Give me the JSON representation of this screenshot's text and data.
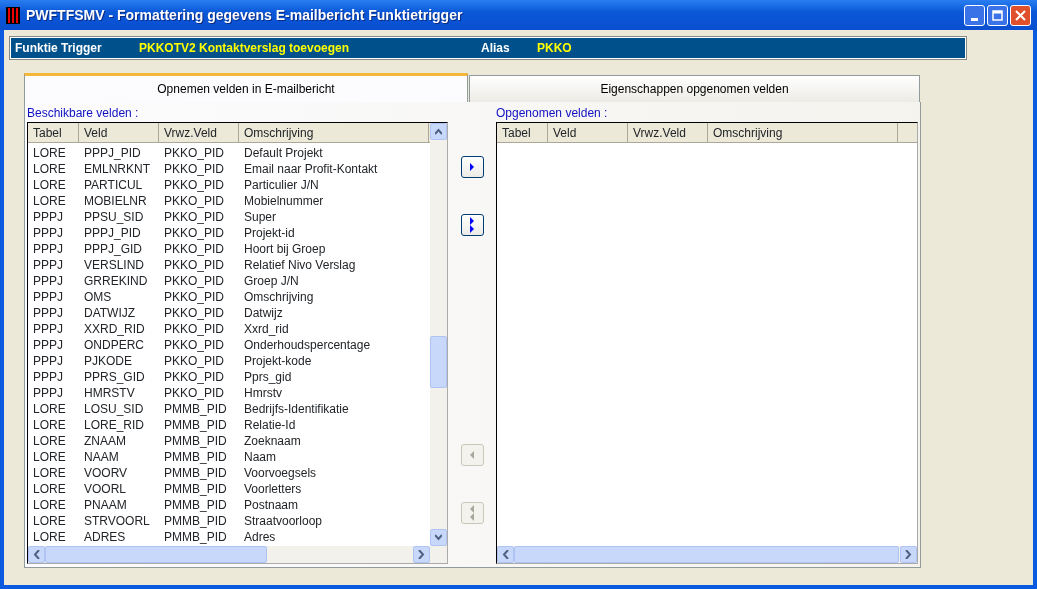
{
  "window": {
    "title": "PWFTFSMV - Formattering gegevens E-mailbericht Funktietrigger"
  },
  "header": {
    "label": "Funktie Trigger",
    "value": "PKKOTV2  Kontaktverslag toevoegen",
    "alias_label": "Alias",
    "alias_value": "PKKO"
  },
  "tabs": [
    {
      "label": "Opnemen velden in E-mailbericht",
      "selected": true
    },
    {
      "label": "Eigenschappen opgenomen velden",
      "selected": false
    }
  ],
  "available": {
    "title": "Beschikbare velden :",
    "columns": [
      "Tabel",
      "Veld",
      "Vrwz.Veld",
      "Omschrijving"
    ],
    "rows": [
      [
        "LORE",
        "PPPJ_PID",
        "PKKO_PID",
        "Default Projekt"
      ],
      [
        "LORE",
        "EMLNRKNT",
        "PKKO_PID",
        "Email naar Profit-Kontakt"
      ],
      [
        "LORE",
        "PARTICUL",
        "PKKO_PID",
        "Particulier J/N"
      ],
      [
        "LORE",
        "MOBIELNR",
        "PKKO_PID",
        "Mobielnummer"
      ],
      [
        "PPPJ",
        "PPSU_SID",
        "PKKO_PID",
        "Super"
      ],
      [
        "PPPJ",
        "PPPJ_PID",
        "PKKO_PID",
        "Projekt-id"
      ],
      [
        "PPPJ",
        "PPPJ_GID",
        "PKKO_PID",
        "Hoort bij Groep"
      ],
      [
        "PPPJ",
        "VERSLIND",
        "PKKO_PID",
        "Relatief Nivo Verslag"
      ],
      [
        "PPPJ",
        "GRREKIND",
        "PKKO_PID",
        "Groep J/N"
      ],
      [
        "PPPJ",
        "OMS",
        "PKKO_PID",
        "Omschrijving"
      ],
      [
        "PPPJ",
        "DATWIJZ",
        "PKKO_PID",
        "Datwijz"
      ],
      [
        "PPPJ",
        "XXRD_RID",
        "PKKO_PID",
        "Xxrd_rid"
      ],
      [
        "PPPJ",
        "ONDPERC",
        "PKKO_PID",
        "Onderhoudspercentage"
      ],
      [
        "PPPJ",
        "PJKODE",
        "PKKO_PID",
        "Projekt-kode"
      ],
      [
        "PPPJ",
        "PPRS_GID",
        "PKKO_PID",
        "Pprs_gid"
      ],
      [
        "PPPJ",
        "HMRSTV",
        "PKKO_PID",
        "Hmrstv"
      ],
      [
        "LORE",
        "LOSU_SID",
        "PMMB_PID",
        "Bedrijfs-Identifikatie"
      ],
      [
        "LORE",
        "LORE_RID",
        "PMMB_PID",
        "Relatie-Id"
      ],
      [
        "LORE",
        "ZNAAM",
        "PMMB_PID",
        "Zoeknaam"
      ],
      [
        "LORE",
        "NAAM",
        "PMMB_PID",
        "Naam"
      ],
      [
        "LORE",
        "VOORV",
        "PMMB_PID",
        "Voorvoegsels"
      ],
      [
        "LORE",
        "VOORL",
        "PMMB_PID",
        "Voorletters"
      ],
      [
        "LORE",
        "PNAAM",
        "PMMB_PID",
        "Postnaam"
      ],
      [
        "LORE",
        "STRVOORL",
        "PMMB_PID",
        "Straatvoorloop"
      ],
      [
        "LORE",
        "ADRES",
        "PMMB_PID",
        "Adres"
      ]
    ]
  },
  "buttons": [
    {
      "kind": "add",
      "disabled": false
    },
    {
      "kind": "add_all",
      "disabled": false
    },
    {
      "kind": "remove",
      "disabled": true
    },
    {
      "kind": "remove_all",
      "disabled": true
    }
  ],
  "included": {
    "title": "Opgenomen velden :",
    "columns": [
      "Tabel",
      "Veld",
      "Vrwz.Veld",
      "Omschrijving"
    ]
  }
}
